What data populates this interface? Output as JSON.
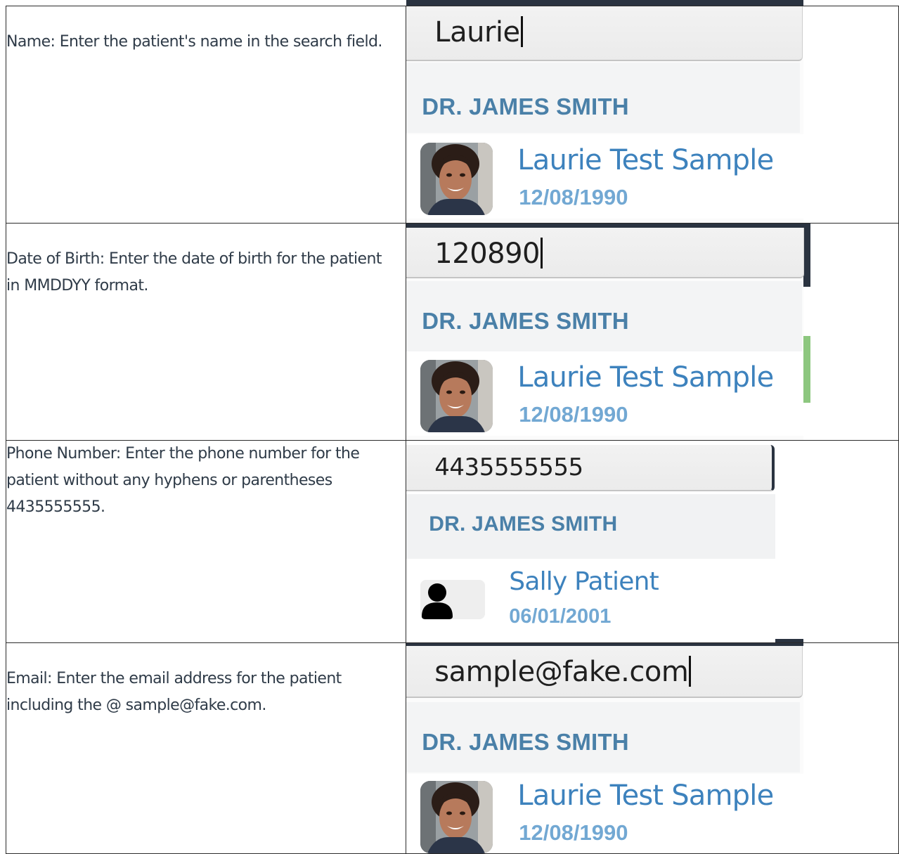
{
  "rows": [
    {
      "description": "Name: Enter the patient's name in the search field.",
      "search_value": "Laurie",
      "doctor_label": "DR. JAMES SMITH",
      "patient_name": "Laurie Test Sample",
      "patient_dob": "12/08/1990",
      "avatar_icon": "patient-photo"
    },
    {
      "description_lines": [
        "Date of Birth: Enter the date of birth for the patient",
        "in MMDDYY format."
      ],
      "search_value": "120890",
      "doctor_label": "DR. JAMES SMITH",
      "patient_name": "Laurie Test Sample",
      "patient_dob": "12/08/1990",
      "avatar_icon": "patient-photo"
    },
    {
      "description_lines": [
        "Phone Number: Enter the phone number for the",
        "patient without any hyphens or parentheses",
        "4435555555."
      ],
      "search_value": "4435555555",
      "doctor_label": "DR. JAMES SMITH",
      "patient_name": "Sally Patient",
      "patient_dob": "06/01/2001",
      "avatar_icon": "person-icon"
    },
    {
      "description_lines": [
        "Email: Enter the email address for the patient",
        "including the @ sample@fake.com."
      ],
      "search_value": "sample@fake.com",
      "doctor_label": "DR. JAMES SMITH",
      "patient_name": "Laurie Test Sample",
      "patient_dob": "12/08/1990",
      "avatar_icon": "patient-photo"
    }
  ],
  "colors": {
    "doctor_label": "#4a80a8",
    "patient_name": "#3d82bd",
    "patient_dob": "#72a8d3",
    "text": "#2f3b48",
    "dark_frame": "#2a3340"
  }
}
